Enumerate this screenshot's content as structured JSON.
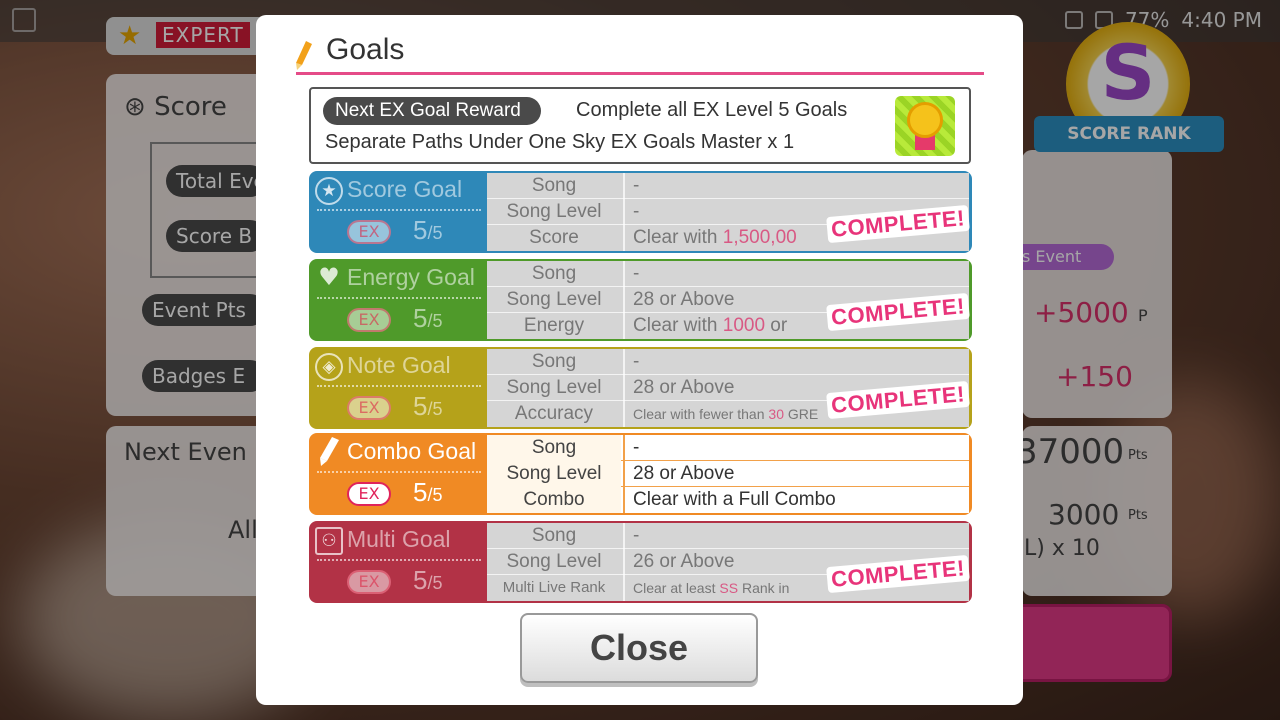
{
  "status_bar": {
    "battery": "77%",
    "time": "4:40 PM"
  },
  "background": {
    "difficulty": "EXPERT",
    "score_label": "Score",
    "total_event_label": "Total Eve",
    "score_bonus_label": "Score B",
    "event_pts_label": "Event Pts",
    "badges_label": "Badges E",
    "next_event_label": "Next Even",
    "all_label": "All",
    "plus_points": "+5000",
    "points_unit": "P",
    "plus_badges": "+150",
    "event_total": "37000",
    "event_total_unit": "Pts",
    "next_pts": "3000",
    "next_pts_unit": "Pts",
    "multiplier": "L) x 10",
    "rank_letter": "S",
    "rank_label": "SCORE RANK",
    "event_chip": "s Event"
  },
  "modal": {
    "title": "Goals",
    "reward": {
      "label": "Next EX Goal Reward",
      "description": "Complete all EX Level 5 Goals",
      "item": "Separate Paths Under One Sky EX Goals Master x 1"
    },
    "goals": [
      {
        "name": "Score Goal",
        "ex": "EX",
        "progress": "5",
        "total": "/5",
        "complete": true,
        "stamp": "COMPLETE!",
        "rows": [
          {
            "key": "Song",
            "value": "-"
          },
          {
            "key": "Song Level",
            "value": "-"
          },
          {
            "key": "Score",
            "value_prefix": "Clear with ",
            "value_highlight": "1,500,00"
          }
        ]
      },
      {
        "name": "Energy Goal",
        "ex": "EX",
        "progress": "5",
        "total": "/5",
        "complete": true,
        "stamp": "COMPLETE!",
        "rows": [
          {
            "key": "Song",
            "value": "-"
          },
          {
            "key": "Song Level",
            "value": "28 or Above"
          },
          {
            "key": "Energy",
            "value_prefix": "Clear with ",
            "value_highlight": "1000",
            "value_suffix": " or"
          }
        ]
      },
      {
        "name": "Note Goal",
        "ex": "EX",
        "progress": "5",
        "total": "/5",
        "complete": true,
        "stamp": "COMPLETE!",
        "rows": [
          {
            "key": "Song",
            "value": "-"
          },
          {
            "key": "Song Level",
            "value": "28 or Above"
          },
          {
            "key": "Accuracy",
            "value_prefix": "Clear with fewer than ",
            "value_highlight": "30",
            "value_suffix": " GRE"
          }
        ]
      },
      {
        "name": "Combo Goal",
        "ex": "EX",
        "progress": "5",
        "total": "/5",
        "complete": false,
        "rows": [
          {
            "key": "Song",
            "value": "-"
          },
          {
            "key": "Song Level",
            "value": "28 or Above"
          },
          {
            "key": "Combo",
            "value": "Clear with a Full Combo"
          }
        ]
      },
      {
        "name": "Multi Goal",
        "ex": "EX",
        "progress": "5",
        "total": "/5",
        "complete": true,
        "stamp": "COMPLETE!",
        "rows": [
          {
            "key": "Song",
            "value": "-"
          },
          {
            "key": "Song Level",
            "value": "26 or Above"
          },
          {
            "key": "Multi Live Rank",
            "value_prefix": "Clear at least ",
            "value_highlight": "SS",
            "value_suffix": " Rank in"
          }
        ]
      }
    ],
    "close_label": "Close"
  },
  "colors": {
    "score": "#2e88b8",
    "energy": "#4f9a2a",
    "note": "#b5a21a",
    "combo": "#f08a24",
    "multi": "#b23246",
    "accent": "#e54b88"
  }
}
